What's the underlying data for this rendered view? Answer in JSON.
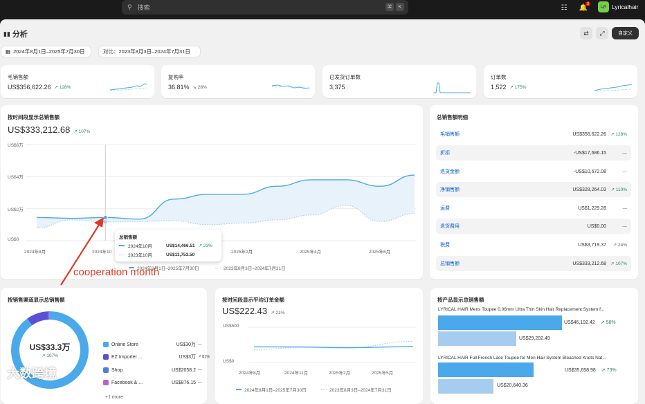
{
  "topbar": {
    "search_placeholder": "搜索",
    "shortcut_1": "⌘",
    "shortcut_2": "K",
    "notification_count": "3",
    "store_initials": "Lyr",
    "store_name": "Lyricalhair"
  },
  "page": {
    "title": "分析",
    "customize_label": "自定义",
    "date_range": "2024年8月1日–2025年7月30日",
    "compare_range": "对比：2023年8月3日–2024年7月31日"
  },
  "kpis": [
    {
      "label": "毛销售额",
      "value": "US$356,622.26",
      "trend": "128%",
      "trend_dir": "up"
    },
    {
      "label": "复购率",
      "value": "36.81%",
      "trend": "28%",
      "trend_dir": "down"
    },
    {
      "label": "已发货订单数",
      "value": "3,375",
      "trend": "",
      "trend_dir": ""
    },
    {
      "label": "订单数",
      "value": "1,522",
      "trend": "175%",
      "trend_dir": "up"
    }
  ],
  "sales_over_time": {
    "title": "按时间段显示总销售额",
    "value": "US$333,212.68",
    "trend": "107%",
    "y_ticks": [
      "US$6万",
      "US$4万",
      "US$2万",
      "US$0"
    ],
    "x_ticks": [
      "2024年8月",
      "2024年10",
      "2025年2月",
      "2025年4月",
      "2025年6月"
    ],
    "legend_current": "2024年8月1日–2025年7月30日",
    "legend_previous": "2023年8月3日–2024年7月31日",
    "tooltip": {
      "title": "总销售额",
      "row1_label": "2024年10月",
      "row1_value": "US$14,466.51",
      "row1_trend": "23%",
      "row2_label": "2023年10月",
      "row2_value": "US$11,753.50"
    }
  },
  "chart_data": [
    {
      "type": "line",
      "title": "按时间段显示总销售额",
      "ylim": [
        0,
        60000
      ],
      "y_tick_labels": [
        "US$0",
        "US$2万",
        "US$4万",
        "US$6万"
      ],
      "x": [
        "2024年8月",
        "2024年9月",
        "2024年10月",
        "2024年11月",
        "2024年12月",
        "2025年1月",
        "2025年2月",
        "2025年3月",
        "2025年4月",
        "2025年5月",
        "2025年6月",
        "2025年7月"
      ],
      "series": [
        {
          "name": "2024年8月1日–2025年7月30日",
          "values": [
            14500,
            14000,
            14466,
            13500,
            26000,
            29000,
            29000,
            34000,
            38000,
            38000,
            34000,
            41000
          ]
        },
        {
          "name": "2023年8月3日–2024年7月31日",
          "values": [
            8000,
            13000,
            11753,
            12000,
            12500,
            10000,
            11000,
            13000,
            16000,
            22000,
            12000,
            17000
          ]
        }
      ]
    },
    {
      "type": "pie",
      "title": "按销售渠道显示总销售额",
      "center_label": "US$33.3万",
      "center_trend": "107%",
      "categories": [
        "Online Store",
        "EZ Importer ...",
        "Shop",
        "Facebook & ..."
      ],
      "values": [
        300000,
        30000,
        2058.2,
        876.15
      ]
    },
    {
      "type": "line",
      "title": "按时间段显示平均订单金额",
      "ylim": [
        0,
        500
      ],
      "y_tick_labels": [
        "US$0",
        "US$500"
      ],
      "x": [
        "2024年8月",
        "2024年11月",
        "2025年2月",
        "2025年5月"
      ],
      "series": [
        {
          "name": "2024年8月1日–2025年7月30日",
          "values": [
            222,
            220,
            210,
            225
          ]
        },
        {
          "name": "2023年8月3日–2024年7月31日",
          "values": [
            180,
            215,
            205,
            300
          ]
        }
      ]
    },
    {
      "type": "bar",
      "title": "按产品显示总销售额",
      "categories": [
        "LYRICAL HAIR Mens Toupee 0.06mm Ultra Thin Skin Hair Replacement System f...",
        "LYRICAL HAIR Full French Lace Toupee for Men Hair System Bleached Knots Nat..."
      ],
      "series": [
        {
          "name": "2024年8月1日–2025年7月30日",
          "values": [
            46192.42,
            35658.98
          ]
        },
        {
          "name": "2023年8月3日–2024年7月31日",
          "values": [
            29202.49,
            20640.36
          ]
        }
      ]
    }
  ],
  "breakdown": {
    "title": "总销售额明细",
    "rows": [
      {
        "label": "毛销售额",
        "value": "US$356,622.26",
        "trend": "128%"
      },
      {
        "label": "折扣",
        "value": "-US$17,686.15",
        "trend": "—"
      },
      {
        "label": "退货金额",
        "value": "-US$10,672.08",
        "trend": "—"
      },
      {
        "label": "净销售额",
        "value": "US$328,264.03",
        "trend": "110%"
      },
      {
        "label": "运费",
        "value": "US$1,229.28",
        "trend": "—"
      },
      {
        "label": "退货费用",
        "value": "US$0.00",
        "trend": "—"
      },
      {
        "label": "税费",
        "value": "US$3,719.37",
        "trend": "24%"
      },
      {
        "label": "总销售额",
        "value": "US$333,212.68",
        "trend": "107%"
      }
    ]
  },
  "channels": {
    "title": "按销售渠道显示总销售额",
    "center_value": "US$33.3万",
    "center_trend": "107%",
    "items": [
      {
        "name": "Online Store",
        "value": "US$30万",
        "trend": "—",
        "color": "#4aa9ea"
      },
      {
        "name": "EZ Importer ...",
        "value": "US$3万",
        "trend": "81%",
        "color": "#5b4fd6"
      },
      {
        "name": "Shop",
        "value": "US$2058.2",
        "trend": "—",
        "color": "#4f7fd8"
      },
      {
        "name": "Facebook & ...",
        "value": "US$876.15",
        "trend": "—",
        "color": "#c25ec9"
      }
    ],
    "more": "+1 more"
  },
  "aov": {
    "title": "按时间段显示平均订单金额",
    "value": "US$222.43",
    "trend": "21%",
    "y_ticks": [
      "US$500",
      "US$0"
    ],
    "x_ticks": [
      "2024年8月",
      "2024年11月",
      "2025年2月",
      "2025年5月"
    ],
    "legend_current": "2024年8月1日–2025年7月30日",
    "legend_previous": "2023年8月3日–2024年7月31日"
  },
  "products": {
    "title": "按产品显示总销售额",
    "items": [
      {
        "name": "LYRICAL HAIR Mens Toupee 0.06mm Ultra Thin Skin Hair Replacement System f...",
        "current": "US$46,192.42",
        "trend": "58%",
        "previous": "US$29,202.49"
      },
      {
        "name": "LYRICAL HAIR Full French Lace Toupee for Men Hair System Bleached Knots Nat...",
        "current": "US$35,658.98",
        "trend": "73%",
        "previous": "US$20,640.36"
      }
    ]
  },
  "annotation": "cooperation month",
  "watermark": "大数跨境",
  "colors": {
    "primary": "#4aa9ea",
    "primary_light": "#a6cdf0",
    "up": "#29845a",
    "link": "#005bd3",
    "annotation": "#e03a25"
  }
}
